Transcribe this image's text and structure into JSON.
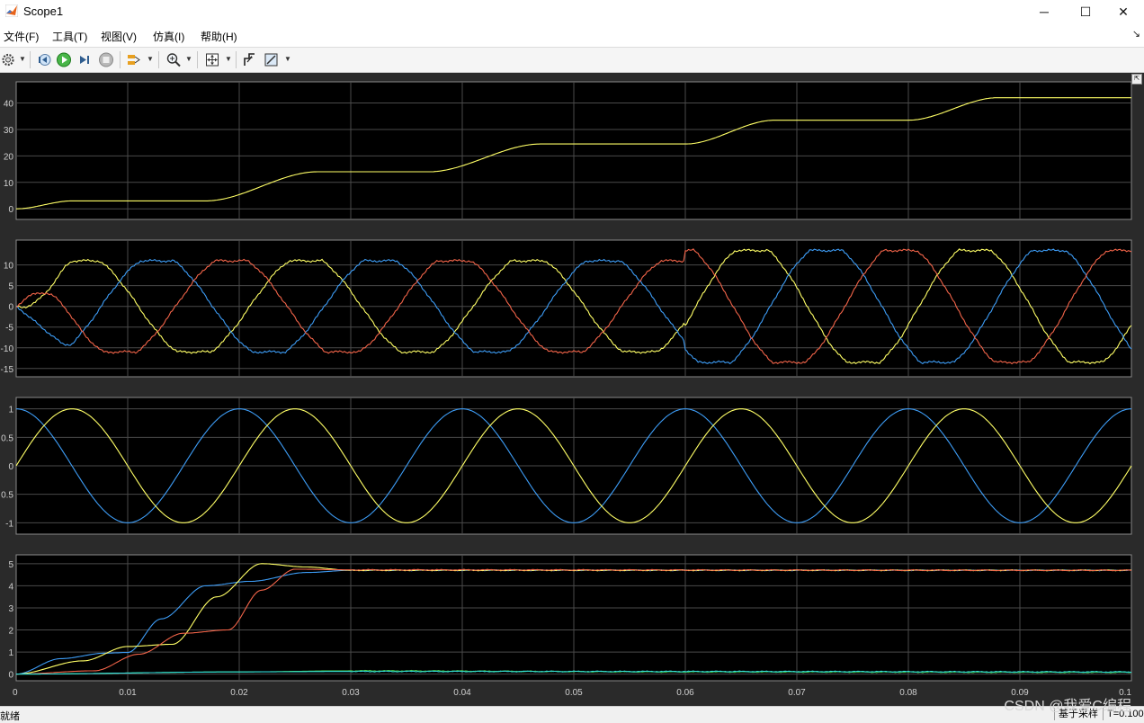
{
  "window": {
    "title": "Scope1",
    "icon": "matlab-logo-icon"
  },
  "menu": [
    "文件(F)",
    "工具(T)",
    "视图(V)",
    "仿真(I)",
    "帮助(H)"
  ],
  "toolbar": {
    "icons": [
      "settings-gear-icon",
      "step-back-icon",
      "run-icon",
      "step-forward-icon",
      "stop-icon",
      "highlight-signal-icon",
      "zoom-icon",
      "fit-axes-icon",
      "triggers-icon",
      "measurements-icon"
    ]
  },
  "colors": {
    "yellow": "#ffff66",
    "blue": "#3d9cf5",
    "red": "#f26449",
    "green": "#44cc44",
    "cyan": "#33dddd",
    "grid": "#4a4a4a",
    "plot_bg": "#000000"
  },
  "chart_data": [
    {
      "type": "line",
      "x_range": [
        0,
        0.1
      ],
      "ylim": [
        -4,
        48
      ],
      "y_ticks": [
        "0",
        "10",
        "20",
        "30",
        "40"
      ],
      "series": [
        {
          "color": "yellow",
          "values": [
            [
              0,
              0
            ],
            [
              0.005,
              3
            ],
            [
              0.017,
              3
            ],
            [
              0.027,
              14
            ],
            [
              0.037,
              14
            ],
            [
              0.047,
              24.5
            ],
            [
              0.06,
              24.5
            ],
            [
              0.068,
              33.5
            ],
            [
              0.08,
              33.5
            ],
            [
              0.088,
              42
            ],
            [
              0.1,
              42
            ]
          ]
        }
      ]
    },
    {
      "type": "line",
      "x_range": [
        0,
        0.1
      ],
      "ylim": [
        -17,
        16
      ],
      "y_ticks": [
        "10",
        "5",
        "0",
        "-5",
        "-10",
        "-15"
      ],
      "series": [
        {
          "color": "yellow",
          "amplitude_start": 11,
          "amplitude_end": 13.5
        },
        {
          "color": "blue",
          "amplitude_start": 11,
          "amplitude_end": 13.5
        },
        {
          "color": "red",
          "amplitude_start": 11,
          "amplitude_end": 13.5
        }
      ]
    },
    {
      "type": "line",
      "x_range": [
        0,
        0.1
      ],
      "ylim": [
        -1.2,
        1.2
      ],
      "y_ticks": [
        "1",
        "0.5",
        "0",
        "0.5",
        "-1"
      ],
      "series": [
        {
          "color": "blue",
          "function": "cos",
          "period": 0.02
        },
        {
          "color": "yellow",
          "function": "sin",
          "period": 0.02
        }
      ]
    },
    {
      "type": "line",
      "x_range": [
        0,
        0.1
      ],
      "ylim": [
        -0.3,
        5.4
      ],
      "y_ticks": [
        "5",
        "4",
        "3",
        "2",
        "1",
        "0"
      ],
      "x_ticks": [
        "0",
        "0.01",
        "0.02",
        "0.03",
        "0.04",
        "0.05",
        "0.06",
        "0.07",
        "0.08",
        "0.09",
        "0.1"
      ],
      "series": [
        {
          "color": "blue",
          "values": [
            [
              0,
              0
            ],
            [
              0.004,
              0.7
            ],
            [
              0.008,
              0.95
            ],
            [
              0.01,
              0.98
            ],
            [
              0.013,
              2.5
            ],
            [
              0.017,
              4
            ],
            [
              0.021,
              4.2
            ],
            [
              0.026,
              4.6
            ],
            [
              0.03,
              4.7
            ],
            [
              0.1,
              4.7
            ]
          ]
        },
        {
          "color": "yellow",
          "values": [
            [
              0,
              0
            ],
            [
              0.006,
              0.6
            ],
            [
              0.01,
              1.25
            ],
            [
              0.014,
              1.35
            ],
            [
              0.018,
              3.5
            ],
            [
              0.022,
              5.0
            ],
            [
              0.026,
              4.85
            ],
            [
              0.03,
              4.7
            ],
            [
              0.1,
              4.7
            ]
          ]
        },
        {
          "color": "red",
          "values": [
            [
              0,
              0
            ],
            [
              0.007,
              0.15
            ],
            [
              0.011,
              0.9
            ],
            [
              0.015,
              1.85
            ],
            [
              0.019,
              2.0
            ],
            [
              0.022,
              3.8
            ],
            [
              0.025,
              4.75
            ],
            [
              0.03,
              4.72
            ],
            [
              0.1,
              4.7
            ]
          ]
        },
        {
          "color": "green",
          "values": [
            [
              0,
              0
            ],
            [
              0.02,
              0.1
            ],
            [
              0.03,
              0.15
            ],
            [
              0.06,
              0.1
            ],
            [
              0.1,
              0.08
            ]
          ]
        },
        {
          "color": "cyan",
          "values": [
            [
              0,
              0
            ],
            [
              0.02,
              0.1
            ],
            [
              0.03,
              0.12
            ],
            [
              0.06,
              0.12
            ],
            [
              0.1,
              0.1
            ]
          ]
        }
      ]
    }
  ],
  "status": {
    "left": "就绪",
    "mode": "基于采样",
    "time": "T=0.100"
  },
  "watermark": "CSDN @我爱C编程"
}
